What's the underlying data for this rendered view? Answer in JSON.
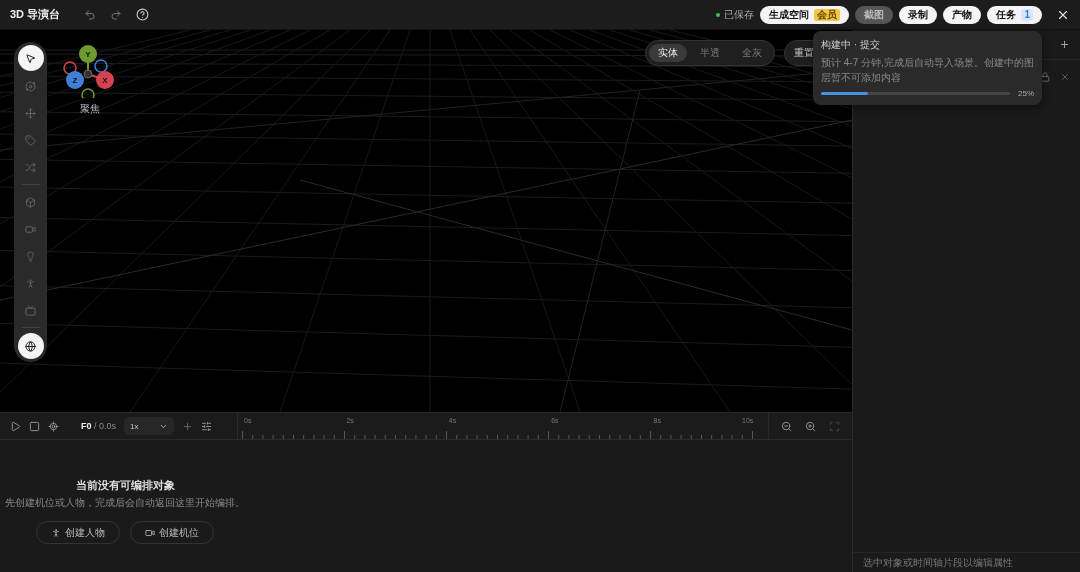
{
  "app_bar": {
    "title": "3D 导演台",
    "save_status": "已保存",
    "actions": [
      {
        "label": "生成空间",
        "badge": {
          "kind": "member",
          "text": "会员"
        },
        "active": false
      },
      {
        "label": "截图",
        "active": true
      },
      {
        "label": "录制",
        "active": false
      },
      {
        "label": "产物",
        "active": false
      },
      {
        "label": "任务",
        "badge": {
          "kind": "count",
          "text": "1"
        },
        "active": false
      }
    ]
  },
  "toolbar": {
    "tools": [
      {
        "kind": "select",
        "selected": true
      },
      {
        "kind": "orbit",
        "selected": false
      },
      {
        "kind": "move",
        "selected": false
      },
      {
        "kind": "tag",
        "selected": false
      },
      {
        "kind": "swap",
        "selected": false
      },
      {
        "kind": "divider"
      },
      {
        "kind": "cube",
        "selected": false
      },
      {
        "kind": "camera",
        "selected": false
      },
      {
        "kind": "light",
        "selected": false
      },
      {
        "kind": "person",
        "selected": false
      },
      {
        "kind": "screen",
        "selected": false
      },
      {
        "kind": "divider"
      },
      {
        "kind": "world",
        "selected": true
      }
    ]
  },
  "gizmo": {
    "axes": [
      {
        "label": "Y",
        "color": "#6f9a2e"
      },
      {
        "label": "Z",
        "color": "#3f7fd6"
      },
      {
        "label": "X",
        "color": "#d6434f"
      }
    ],
    "label": "聚焦"
  },
  "view_modes": [
    {
      "label": "实体",
      "selected": true
    },
    {
      "label": "半透",
      "selected": false
    },
    {
      "label": "全灰",
      "selected": false
    }
  ],
  "reset_button": "重置",
  "build_popover": {
    "title": "构建中 · 提交",
    "message": "预计 4-7 分钟,完成后自动导入场景。创建中的图层暂不可添加内容",
    "level": 0.25,
    "percent": "25%"
  },
  "timeline": {
    "frame": "F0",
    "time": "/ 0.0s",
    "speed": "1x",
    "ruler": [
      "0s",
      "2s",
      "4s",
      "6s",
      "8s",
      "10s"
    ]
  },
  "empty_state": {
    "title": "当前没有可编排对象",
    "message": "先创建机位或人物，完成后会自动返回这里开始编排。",
    "buttons": [
      {
        "kind": "person",
        "label": "创建人物"
      },
      {
        "kind": "camera",
        "label": "创建机位"
      }
    ]
  },
  "inspector": {
    "footer": "选中对象或时间轴片段以编辑属性"
  }
}
